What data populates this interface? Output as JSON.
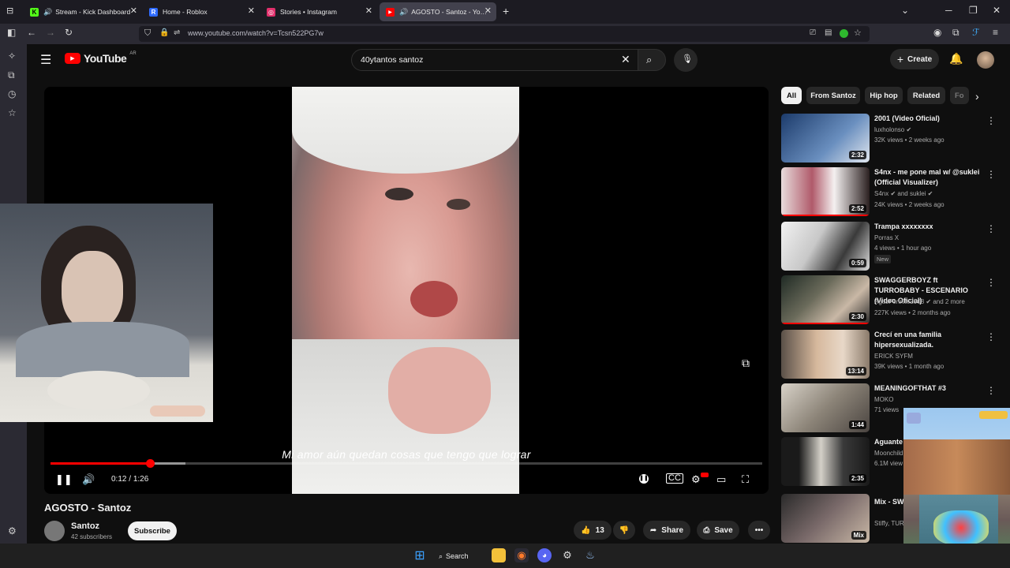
{
  "browser": {
    "tabs": [
      {
        "title": "Stream - Kick Dashboard",
        "favicon_text": "K",
        "favicon_color": "#53fc18"
      },
      {
        "title": "Home - Roblox",
        "favicon_text": "R",
        "favicon_color": "#2f6bff"
      },
      {
        "title": "Stories • Instagram",
        "favicon_text": "◎",
        "favicon_color": "#e1306c"
      },
      {
        "title": "AGOSTO - Santoz - YouTube",
        "favicon_text": "▶",
        "favicon_color": "#ff0000"
      }
    ],
    "new_tab": "+",
    "url": "www.youtube.com/watch?v=Tcsn522PG7w"
  },
  "youtube": {
    "logo_text": "YouTube",
    "logo_country": "AR",
    "search_query": "40ytantos santoz",
    "create_label": "Create",
    "player": {
      "caption": "Mi amor aún quedan cosas que tengo que lograr",
      "time_current": "0:12",
      "time_separator": " / ",
      "time_total": "1:26",
      "progress_fraction": 0.14,
      "buffer_fraction": 0.19
    },
    "video_title": "AGOSTO - Santoz",
    "channel": {
      "name": "Santoz",
      "subscribers": "42 subscribers",
      "subscribe_label": "Subscribe"
    },
    "actions": {
      "likes": "13",
      "share_label": "Share",
      "save_label": "Save",
      "more_label": "•••"
    },
    "chips": [
      "All",
      "From Santoz",
      "Hip hop",
      "Related",
      "Fo"
    ],
    "recommendations": [
      {
        "title": "2001 (Video Oficial)",
        "channel": "luxholonso",
        "verified": true,
        "meta": "32K views • 2 weeks ago",
        "duration": "2:32",
        "watched_fraction": 0
      },
      {
        "title": "S4nx - me pone mal w/ @suklei (Official Visualizer)",
        "channel": "S4nx",
        "channel_extra": "and suklei",
        "verified": true,
        "meta": "24K views • 2 weeks ago",
        "duration": "2:52",
        "watched_fraction": 1
      },
      {
        "title": "Trampa xxxxxxxx",
        "channel": "Porras X",
        "verified": false,
        "meta": "4 views • 1 hour ago",
        "badge": "New",
        "duration": "0:59",
        "watched_fraction": 0
      },
      {
        "title": "SWAGGERBOYZ ft TURROBABY - ESCENARIO (Video Oficial)",
        "channel": "AgusFortnite2008",
        "channel_extra": "and 2 more",
        "verified": true,
        "meta": "227K views • 2 months ago",
        "duration": "2:30",
        "watched_fraction": 1
      },
      {
        "title": "Crecí en una familia hipersexualizada.",
        "channel": "ERICK SYFM",
        "verified": false,
        "meta": "39K views • 1 month ago",
        "duration": "13:14",
        "watched_fraction": 0
      },
      {
        "title": "MEANINGOFTHAT #3",
        "channel": "MOKO",
        "verified": false,
        "meta": "71 views",
        "duration": "1:44",
        "watched_fraction": 0
      },
      {
        "title": "Aguante",
        "channel": "Moonchild",
        "verified": false,
        "meta": "6.1M view",
        "duration": "2:35",
        "watched_fraction": 0
      },
      {
        "title": "Mix - SW TURROB",
        "channel": "Stiffy, TUR",
        "verified": false,
        "meta": "",
        "duration": "Mix",
        "watched_fraction": 0
      }
    ]
  },
  "taskbar": {
    "search_label": "Search"
  },
  "colors": {
    "accent_red": "#ff0000",
    "bg": "#0f0f0f"
  }
}
